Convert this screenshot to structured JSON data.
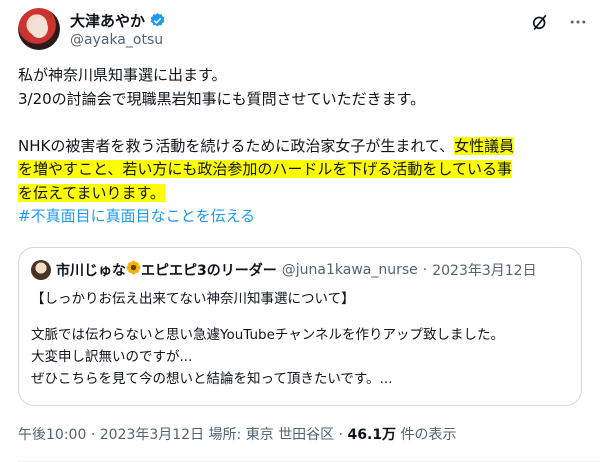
{
  "author": {
    "display_name": "大津あやか",
    "handle": "@ayaka_otsu"
  },
  "tweet": {
    "line1": "私が神奈川県知事選に出ます。",
    "line2": "3/20の討論会で現職黒岩知事にも質問させていただきます。",
    "para2_plain": "NHKの被害者を救う活動を続けるために政治家女子が生まれて、",
    "para2_highlight_1": "女性議員",
    "para2_highlight_2": "を増やすこと、若い方にも政治参加のハードルを下げる活動をしている事",
    "para2_highlight_3": "を伝えてまいります。",
    "hashtag": "#不真面目に真面目なことを伝える",
    "highlight_color": "#fdff00"
  },
  "quote": {
    "name_before": "市川じゅな",
    "name_after": "エピエピ3のリーダー",
    "handle": "@juna1kawa_nurse",
    "separator": "·",
    "date": "2023年3月12日",
    "line1": "【しっかりお伝え出来てない神奈川知事選について】",
    "line2": "文脈では伝わらないと思い急遽YouTubeチャンネルを作りアップ致しました。",
    "line3": "大変申し訳無いのですが...",
    "line4": "ぜひこちらを見て今の想いと結論を知って頂きたいです。..."
  },
  "meta": {
    "time": "午後10:00",
    "separator": "·",
    "date": "2023年3月12日",
    "location": "場所: 東京 世田谷区",
    "views": "46.1万",
    "views_label": "件の表示"
  },
  "colors": {
    "link": "#1d9bf0",
    "muted": "#536471",
    "text": "#0f1419"
  },
  "icons": {
    "verified": "verified-badge-icon",
    "grok": "grok-icon",
    "more": "more-icon",
    "sunflower": "sunflower-emoji-icon"
  }
}
